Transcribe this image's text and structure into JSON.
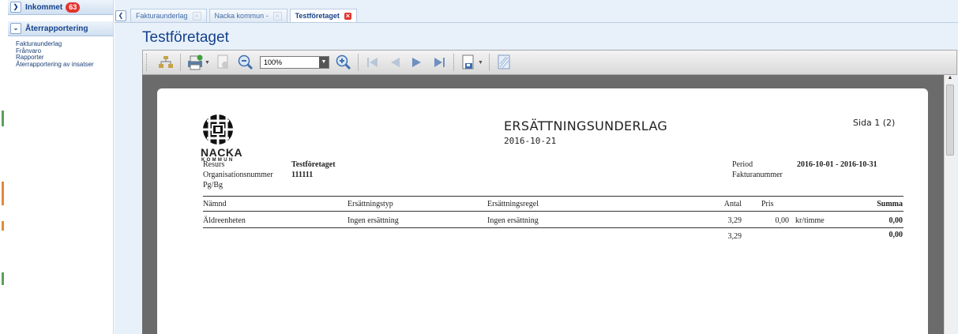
{
  "sidebar": {
    "inbox": {
      "label": "Inkommet",
      "count": "63"
    },
    "section": {
      "label": "Återrapportering"
    },
    "links": [
      {
        "label": "Fakturaunderlag"
      },
      {
        "label": "Frånvaro"
      },
      {
        "label": "Rapporter"
      },
      {
        "label": "Återrapportering av insatser"
      }
    ]
  },
  "tabs": [
    {
      "label": "Fakturaunderlag"
    },
    {
      "label": "Nacka kommun -"
    },
    {
      "label": "Testföretaget"
    }
  ],
  "page_title": "Testföretaget",
  "toolbar": {
    "zoom_value": "100%"
  },
  "report": {
    "logo_name": "NACKA",
    "logo_sub": "KOMMUN",
    "title": "ERSÄTTNINGSUNDERLAG",
    "date": "2016-10-21",
    "page": "Sida 1 (2)",
    "fields": {
      "resurs_label": "Resurs",
      "resurs_value": "Testföretaget",
      "org_label": "Organisationsnummer",
      "org_value": "111111",
      "pgbg_label": "Pg/Bg",
      "period_label": "Period",
      "period_value": "2016-10-01 - 2016-10-31",
      "faktura_label": "Fakturanummer"
    },
    "columns": {
      "namnd": "Nämnd",
      "typ": "Ersättningstyp",
      "regel": "Ersättningsregel",
      "antal": "Antal",
      "pris": "Pris",
      "summa": "Summa"
    },
    "row": {
      "namnd": "Äldreenheten",
      "typ": "Ingen ersättning",
      "regel": "Ingen ersättning",
      "antal": "3,29",
      "pris": "0,00",
      "enhet": "kr/timme",
      "summa": "0,00"
    },
    "total": {
      "antal": "3,29",
      "summa": "0,00"
    }
  }
}
